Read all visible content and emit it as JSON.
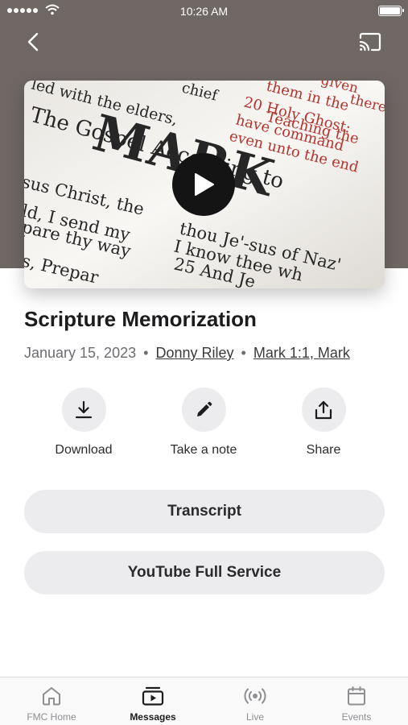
{
  "status_bar": {
    "time": "10:26 AM",
    "signal_icon": "signal-dots-icon",
    "wifi_icon": "wifi-icon",
    "battery_icon": "battery-icon"
  },
  "nav": {
    "back_icon": "chevron-left-icon",
    "cast_icon": "cast-icon"
  },
  "media": {
    "image_text": {
      "line1": "led with the elders,",
      "line2": "The Gospel According to",
      "line3": "MARK",
      "line4": "sus Christ, the",
      "line5": "ld, I send my",
      "line6": "pare thy way",
      "line7": "s, Prepar",
      "line8": "thou Je'-sus of Naz'",
      "line9": "I know thee wh",
      "line10": "25 And Je",
      "right1": "them in the",
      "right2": "20 Holy Ghost:",
      "right3": "Teaching the",
      "right4": "have command",
      "right5": "even unto the end",
      "chief": "chief",
      "given": "given",
      "there": "there"
    },
    "play_icon": "play-icon"
  },
  "message": {
    "title": "Scripture Memorization",
    "date": "January 15, 2023",
    "separator": "•",
    "speaker": "Donny Riley",
    "scripture": "Mark 1:1, Mark"
  },
  "actions": [
    {
      "label": "Download",
      "icon": "download-icon"
    },
    {
      "label": "Take a note",
      "icon": "pencil-icon"
    },
    {
      "label": "Share",
      "icon": "share-icon"
    }
  ],
  "buttons": {
    "transcript": "Transcript",
    "youtube": "YouTube Full Service"
  },
  "tabs": [
    {
      "label": "FMC Home",
      "icon": "home-icon",
      "active": false
    },
    {
      "label": "Messages",
      "icon": "messages-icon",
      "active": true
    },
    {
      "label": "Live",
      "icon": "live-broadcast-icon",
      "active": false
    },
    {
      "label": "Events",
      "icon": "calendar-icon",
      "active": false
    }
  ],
  "colors": {
    "header_background": "#6f6764",
    "button_background": "#ececee",
    "scripture_red": "#b5332d"
  }
}
